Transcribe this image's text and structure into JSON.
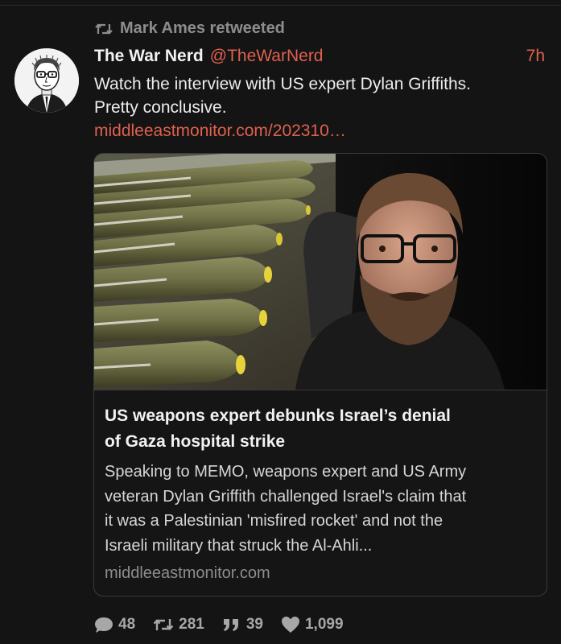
{
  "retweet": {
    "icon": "retweet-icon",
    "label": "Mark Ames retweeted"
  },
  "tweet": {
    "avatar_icon": "cartoon-portrait-avatar",
    "display_name": "The War Nerd",
    "handle": "@TheWarNerd",
    "timestamp": "7h",
    "text_line1": "Watch the interview with US expert Dylan Griffiths.",
    "text_line2": "Pretty conclusive.",
    "link": "middleeastmonitor.com/202310…"
  },
  "card": {
    "image_icon": "video-thumbnail-bombs-and-bearded-man",
    "title_line1": "US weapons expert debunks Israel’s denial",
    "title_line2": "of Gaza hospital strike",
    "desc_line1": "Speaking to MEMO, weapons expert and US Army",
    "desc_line2": "veteran Dylan Griffith challenged Israel's claim that",
    "desc_line3": "it was a Palestinian 'misfired rocket' and not the",
    "desc_line4": "Israeli military that struck the Al-Ahli...",
    "domain": "middleeastmonitor.com"
  },
  "actions": {
    "replies": "48",
    "retweets": "281",
    "quotes": "39",
    "likes": "1,099",
    "icons": [
      "reply-icon",
      "retweet-icon",
      "quote-icon",
      "heart-icon"
    ]
  },
  "colors": {
    "background": "#141414",
    "accent": "#e0604e",
    "muted": "#8d8d8d",
    "border": "#3a3a3a"
  }
}
